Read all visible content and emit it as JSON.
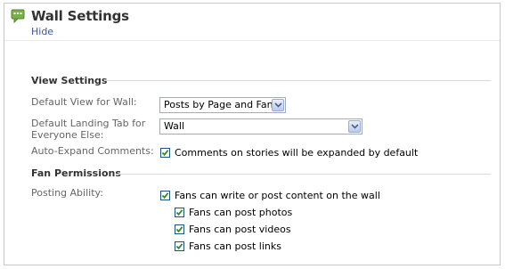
{
  "header": {
    "title": "Wall Settings",
    "hide_label": "Hide",
    "icon": "wall-chat-bubble-icon",
    "icon_color": "#7ab04a"
  },
  "view_settings": {
    "title": "View Settings",
    "default_view": {
      "label": "Default View for Wall:",
      "value": "Posts by Page and Fans"
    },
    "landing_tab": {
      "label_line1": "Default Landing Tab for",
      "label_line2": "Everyone Else:",
      "value": "Wall"
    },
    "auto_expand": {
      "label": "Auto-Expand Comments:",
      "checkbox_label": "Comments on stories will be expanded by default",
      "checked": true
    }
  },
  "fan_permissions": {
    "title": "Fan Permissions",
    "posting_ability_label": "Posting Ability:",
    "main_option": {
      "label": "Fans can write or post content on the wall",
      "checked": true
    },
    "sub_options": [
      {
        "label": "Fans can post photos",
        "checked": true
      },
      {
        "label": "Fans can post videos",
        "checked": true
      },
      {
        "label": "Fans can post links",
        "checked": true
      }
    ]
  },
  "colors": {
    "link": "#3b5998",
    "checkmark": "#2e8b20"
  }
}
